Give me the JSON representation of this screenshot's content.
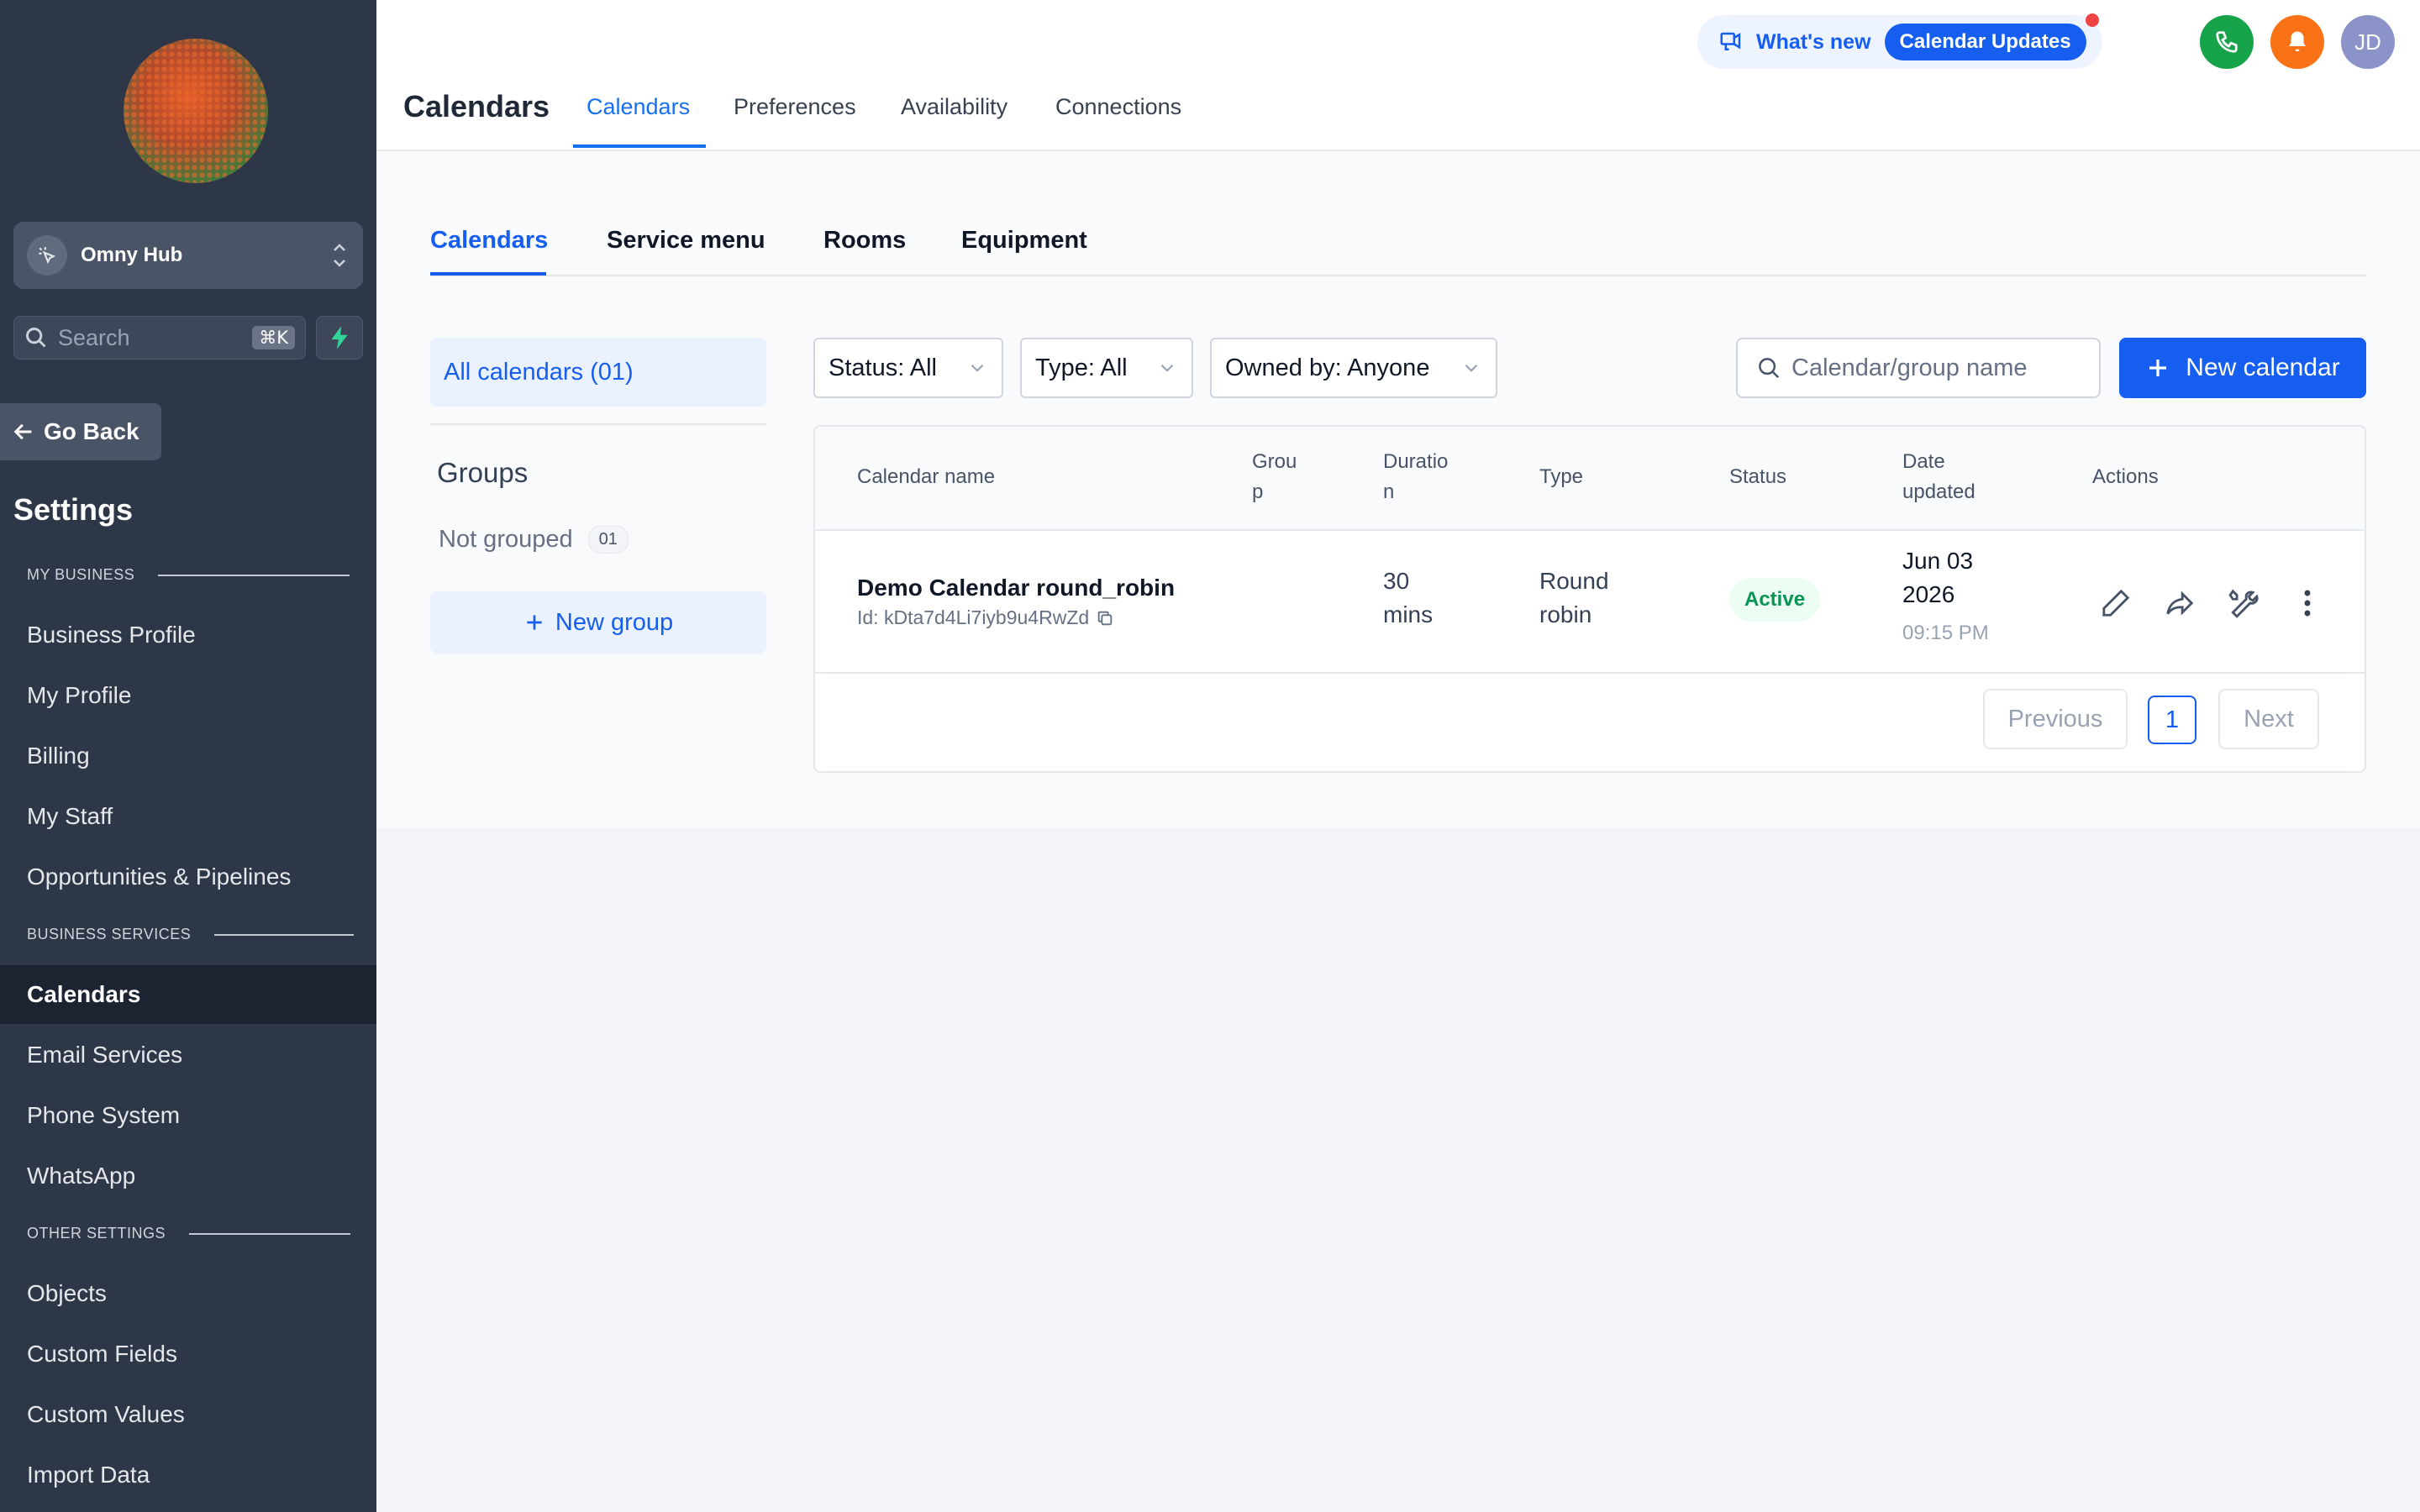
{
  "workspace": {
    "name": "Omny Hub"
  },
  "search": {
    "placeholder": "Search",
    "shortcut": "⌘K"
  },
  "go_back": "Go Back",
  "settings_title": "Settings",
  "sections": {
    "my_business": "MY BUSINESS",
    "business_services": "BUSINESS SERVICES",
    "other_settings": "OTHER SETTINGS"
  },
  "nav": {
    "business_profile": "Business Profile",
    "my_profile": "My Profile",
    "billing": "Billing",
    "my_staff": "My Staff",
    "opportunities": "Opportunities & Pipelines",
    "calendars": "Calendars",
    "email_services": "Email Services",
    "phone_system": "Phone System",
    "whatsapp": "WhatsApp",
    "objects": "Objects",
    "custom_fields": "Custom Fields",
    "custom_values": "Custom Values",
    "import_data": "Import Data"
  },
  "topbar": {
    "title": "Calendars",
    "tabs": [
      "Calendars",
      "Preferences",
      "Availability",
      "Connections"
    ],
    "whats_new": "What's new",
    "whats_new_pill": "Calendar Updates",
    "avatar": "JD"
  },
  "subtabs": [
    "Calendars",
    "Service menu",
    "Rooms",
    "Equipment"
  ],
  "left_panel": {
    "all_calendars": "All calendars (01)",
    "groups_title": "Groups",
    "not_grouped": "Not grouped",
    "not_grouped_count": "01",
    "new_group": "New group"
  },
  "filters": {
    "status": "Status: All",
    "type": "Type: All",
    "owned_by": "Owned by: Anyone",
    "search_placeholder": "Calendar/group name",
    "new_calendar": "New calendar"
  },
  "table": {
    "headers": {
      "name": "Calendar name",
      "group_1": "Grou",
      "group_2": "p",
      "duration_1": "Duratio",
      "duration_2": "n",
      "type": "Type",
      "status": "Status",
      "date_1": "Date",
      "date_2": "updated",
      "actions": "Actions"
    },
    "rows": [
      {
        "name": "Demo Calendar round_robin",
        "id": "Id: kDta7d4Li7iyb9u4RwZd",
        "duration_1": "30",
        "duration_2": "mins",
        "type_1": "Round",
        "type_2": "robin",
        "status": "Active",
        "date_1": "Jun 03",
        "date_2": "2026",
        "time": "09:15 PM"
      }
    ]
  },
  "pagination": {
    "previous": "Previous",
    "page": "1",
    "next": "Next"
  },
  "colors": {
    "primary": "#155eef",
    "sidebar": "#2e3748",
    "active_green": "#079455",
    "phone_green": "#16a34a",
    "bell_orange": "#f97316",
    "avatar_purple": "#8b93c9"
  }
}
